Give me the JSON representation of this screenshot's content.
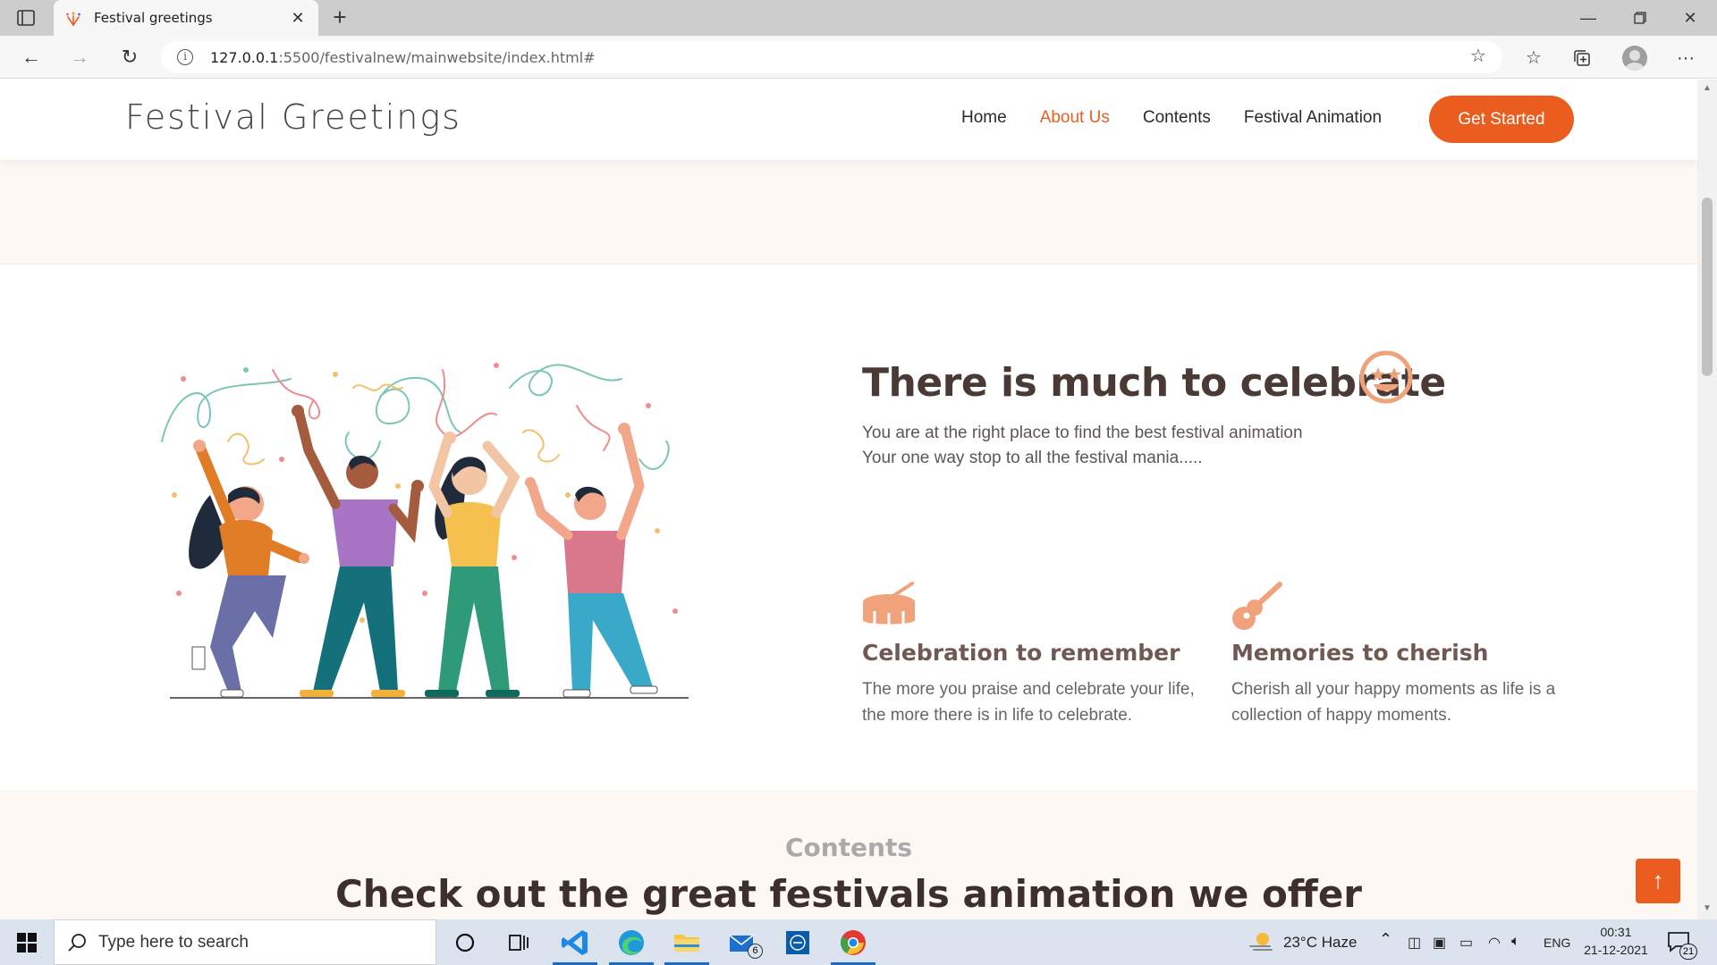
{
  "browser": {
    "tab_title": "Festival greetings",
    "url_host": "127.0.0.1",
    "url_rest": ":5500/festivalnew/mainwebsite/index.html#"
  },
  "site": {
    "logo": "Festival Greetings",
    "menu": [
      {
        "label": "Home",
        "active": false
      },
      {
        "label": "About Us",
        "active": true
      },
      {
        "label": "Contents",
        "active": false
      },
      {
        "label": "Festival Animation",
        "active": false
      }
    ],
    "cta_label": "Get Started",
    "accent_color": "#eb5d1e"
  },
  "about": {
    "title": "There is much to celebrate",
    "subtitle_line1": "You are at the right place to find the best festival animation",
    "subtitle_line2": "Your one way stop to all the festival mania.....",
    "features": [
      {
        "icon": "drum-icon",
        "title": "Celebration to remember",
        "text": "The more you praise and celebrate your life, the more there is in life to celebrate."
      },
      {
        "icon": "guitar-icon",
        "title": "Memories to cherish",
        "text": "Cherish all your happy moments as life is a collection of happy moments."
      }
    ]
  },
  "contents": {
    "label": "Contents",
    "heading": "Check out the great festivals animation we offer"
  },
  "taskbar": {
    "search_placeholder": "Type here to search",
    "weather": "23°C  Haze",
    "lang": "ENG",
    "time": "00:31",
    "date": "21-12-2021",
    "mail_badge": "6",
    "notif_badge": "21"
  }
}
